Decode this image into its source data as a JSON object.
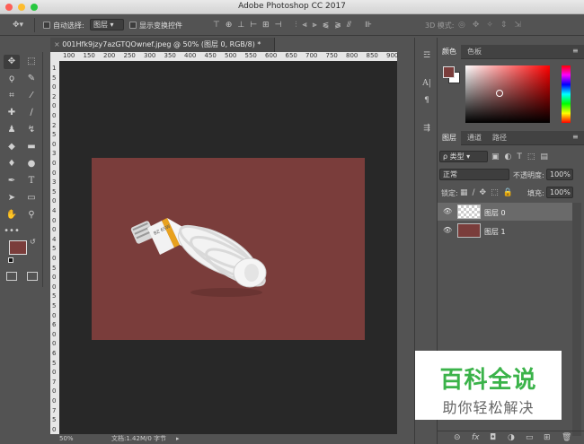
{
  "window": {
    "title": "Adobe Photoshop CC 2017"
  },
  "options_bar": {
    "auto_select_label": "自动选择:",
    "auto_select_value": "图层",
    "show_transform_label": "显示变换控件",
    "mode_3d_label": "3D 模式:"
  },
  "document": {
    "tab_title": "001Hfk9jzy7azGTQOwnef.jpeg @ 50% (图层 0, RGB/8) *",
    "ruler_h": [
      "100",
      "150",
      "200",
      "250",
      "300",
      "350",
      "400",
      "450",
      "500",
      "550",
      "600",
      "650",
      "700",
      "750",
      "800",
      "850",
      "900"
    ],
    "ruler_v": [
      "1",
      "5",
      "0",
      "2",
      "0",
      "0",
      "2",
      "5",
      "0",
      "3",
      "0",
      "0",
      "3",
      "5",
      "0",
      "4",
      "0",
      "0",
      "4",
      "5",
      "0",
      "5",
      "0",
      "0",
      "5",
      "5",
      "0",
      "6",
      "0",
      "0",
      "6",
      "5",
      "0",
      "7",
      "0",
      "0",
      "7",
      "5",
      "0"
    ],
    "canvas_color": "#7a3d3b",
    "zoom": "50%",
    "doc_info": "文档:1.42M/0 字节"
  },
  "color_panel": {
    "tabs": [
      "颜色",
      "色板"
    ],
    "foreground_color": "#7a3d3b",
    "background_color": "#ffffff"
  },
  "layers_panel": {
    "tabs": [
      "图层",
      "通道",
      "路径"
    ],
    "filter_label": "ρ 类型",
    "blend_mode": "正常",
    "opacity_label": "不透明度:",
    "opacity_value": "100%",
    "lock_label": "锁定:",
    "fill_label": "填充:",
    "fill_value": "100%",
    "layers": [
      {
        "name": "图层 0",
        "selected": true
      },
      {
        "name": "图层 1",
        "selected": false
      }
    ],
    "footer_fx": "fx"
  },
  "watermark": {
    "title": "百科全说",
    "subtitle": "助你轻松解决"
  }
}
